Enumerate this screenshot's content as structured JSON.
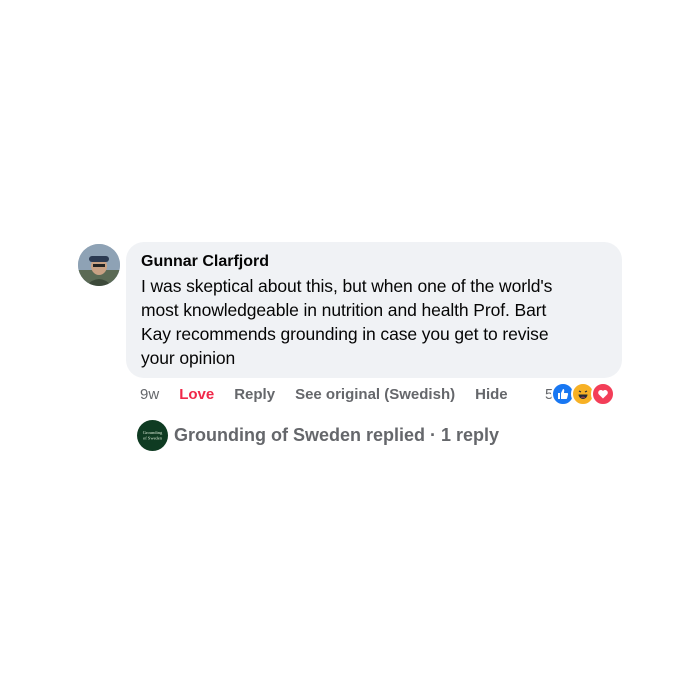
{
  "comment": {
    "author": "Gunnar Clarfjord",
    "lines": [
      "I was skeptical about this, but when one of the world's",
      "most knowledgeable in nutrition and health Prof. Bart",
      "Kay recommends grounding in case you get to revise",
      "your opinion"
    ],
    "time": "9w",
    "actions": {
      "love": "Love",
      "reply": "Reply",
      "see_original": "See original (Swedish)",
      "hide": "Hide"
    },
    "reactions": {
      "count": "5",
      "types": [
        "like-icon",
        "haha-icon",
        "love-icon"
      ]
    }
  },
  "reply_summary": {
    "text": "Grounding of Sweden replied · 1 reply",
    "page_avatar_text": [
      "Grounding",
      "of Sweden"
    ]
  },
  "colors": {
    "bubble": "#f0f2f5",
    "meta": "#65676b",
    "love": "#f02849",
    "like": "#1877f2"
  }
}
